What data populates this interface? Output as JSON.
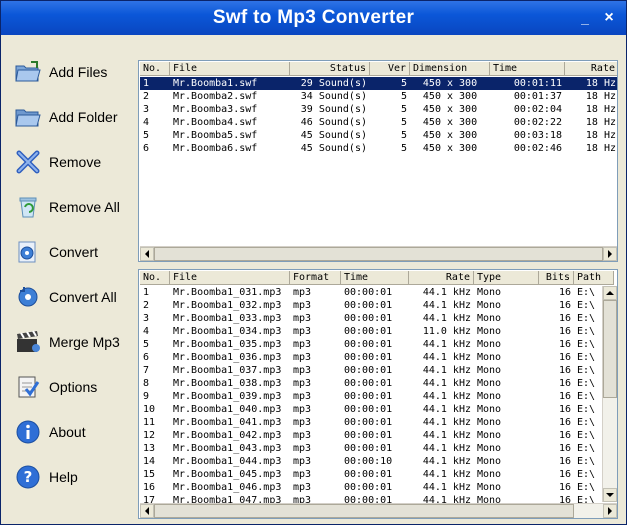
{
  "window": {
    "title": "Swf to Mp3 Converter",
    "minimize": "_",
    "close": "×"
  },
  "colors": {
    "titlebar": "#0b57d8",
    "selection": "#0a246a",
    "face": "#ece9d8"
  },
  "sidebar": {
    "items": [
      {
        "label": "Add Files",
        "icon": "folder-add-files-icon"
      },
      {
        "label": "Add Folder",
        "icon": "folder-icon"
      },
      {
        "label": "Remove",
        "icon": "x-remove-icon"
      },
      {
        "label": "Remove All",
        "icon": "recycle-bin-icon"
      },
      {
        "label": "Convert",
        "icon": "disc-convert-icon"
      },
      {
        "label": "Convert All",
        "icon": "disc-convert-all-icon"
      },
      {
        "label": "Merge Mp3",
        "icon": "clapper-icon"
      },
      {
        "label": "Options",
        "icon": "checklist-icon"
      },
      {
        "label": "About",
        "icon": "info-icon"
      },
      {
        "label": "Help",
        "icon": "help-icon"
      }
    ]
  },
  "source_table": {
    "headers": {
      "no": "No.",
      "file": "File",
      "status": "Status",
      "ver": "Ver",
      "dimension": "Dimension",
      "time": "Time",
      "rate": "Rate"
    },
    "rows": [
      {
        "no": "1",
        "file": "Mr.Boomba1.swf",
        "status": "29 Sound(s)",
        "ver": "5",
        "dimension": "450 x 300",
        "time": "00:01:11",
        "rate": "18 Hz"
      },
      {
        "no": "2",
        "file": "Mr.Boomba2.swf",
        "status": "34 Sound(s)",
        "ver": "5",
        "dimension": "450 x 300",
        "time": "00:01:37",
        "rate": "18 Hz"
      },
      {
        "no": "3",
        "file": "Mr.Boomba3.swf",
        "status": "39 Sound(s)",
        "ver": "5",
        "dimension": "450 x 300",
        "time": "00:02:04",
        "rate": "18 Hz"
      },
      {
        "no": "4",
        "file": "Mr.Boomba4.swf",
        "status": "46 Sound(s)",
        "ver": "5",
        "dimension": "450 x 300",
        "time": "00:02:22",
        "rate": "18 Hz"
      },
      {
        "no": "5",
        "file": "Mr.Boomba5.swf",
        "status": "45 Sound(s)",
        "ver": "5",
        "dimension": "450 x 300",
        "time": "00:03:18",
        "rate": "18 Hz"
      },
      {
        "no": "6",
        "file": "Mr.Boomba6.swf",
        "status": "45 Sound(s)",
        "ver": "5",
        "dimension": "450 x 300",
        "time": "00:02:46",
        "rate": "18 Hz"
      }
    ]
  },
  "sound_table": {
    "headers": {
      "no": "No.",
      "file": "File",
      "format": "Format",
      "time": "Time",
      "rate": "Rate",
      "type": "Type",
      "bits": "Bits",
      "path": "Path"
    },
    "rows": [
      {
        "no": "1",
        "file": "Mr.Boomba1_031.mp3",
        "format": "mp3",
        "time": "00:00:01",
        "rate": "44.1 kHz",
        "type": "Mono",
        "bits": "16",
        "path": "E:\\"
      },
      {
        "no": "2",
        "file": "Mr.Boomba1_032.mp3",
        "format": "mp3",
        "time": "00:00:01",
        "rate": "44.1 kHz",
        "type": "Mono",
        "bits": "16",
        "path": "E:\\"
      },
      {
        "no": "3",
        "file": "Mr.Boomba1_033.mp3",
        "format": "mp3",
        "time": "00:00:01",
        "rate": "44.1 kHz",
        "type": "Mono",
        "bits": "16",
        "path": "E:\\"
      },
      {
        "no": "4",
        "file": "Mr.Boomba1_034.mp3",
        "format": "mp3",
        "time": "00:00:01",
        "rate": "11.0 kHz",
        "type": "Mono",
        "bits": "16",
        "path": "E:\\"
      },
      {
        "no": "5",
        "file": "Mr.Boomba1_035.mp3",
        "format": "mp3",
        "time": "00:00:01",
        "rate": "44.1 kHz",
        "type": "Mono",
        "bits": "16",
        "path": "E:\\"
      },
      {
        "no": "6",
        "file": "Mr.Boomba1_036.mp3",
        "format": "mp3",
        "time": "00:00:01",
        "rate": "44.1 kHz",
        "type": "Mono",
        "bits": "16",
        "path": "E:\\"
      },
      {
        "no": "7",
        "file": "Mr.Boomba1_037.mp3",
        "format": "mp3",
        "time": "00:00:01",
        "rate": "44.1 kHz",
        "type": "Mono",
        "bits": "16",
        "path": "E:\\"
      },
      {
        "no": "8",
        "file": "Mr.Boomba1_038.mp3",
        "format": "mp3",
        "time": "00:00:01",
        "rate": "44.1 kHz",
        "type": "Mono",
        "bits": "16",
        "path": "E:\\"
      },
      {
        "no": "9",
        "file": "Mr.Boomba1_039.mp3",
        "format": "mp3",
        "time": "00:00:01",
        "rate": "44.1 kHz",
        "type": "Mono",
        "bits": "16",
        "path": "E:\\"
      },
      {
        "no": "10",
        "file": "Mr.Boomba1_040.mp3",
        "format": "mp3",
        "time": "00:00:01",
        "rate": "44.1 kHz",
        "type": "Mono",
        "bits": "16",
        "path": "E:\\"
      },
      {
        "no": "11",
        "file": "Mr.Boomba1_041.mp3",
        "format": "mp3",
        "time": "00:00:01",
        "rate": "44.1 kHz",
        "type": "Mono",
        "bits": "16",
        "path": "E:\\"
      },
      {
        "no": "12",
        "file": "Mr.Boomba1_042.mp3",
        "format": "mp3",
        "time": "00:00:01",
        "rate": "44.1 kHz",
        "type": "Mono",
        "bits": "16",
        "path": "E:\\"
      },
      {
        "no": "13",
        "file": "Mr.Boomba1_043.mp3",
        "format": "mp3",
        "time": "00:00:01",
        "rate": "44.1 kHz",
        "type": "Mono",
        "bits": "16",
        "path": "E:\\"
      },
      {
        "no": "14",
        "file": "Mr.Boomba1_044.mp3",
        "format": "mp3",
        "time": "00:00:10",
        "rate": "44.1 kHz",
        "type": "Mono",
        "bits": "16",
        "path": "E:\\"
      },
      {
        "no": "15",
        "file": "Mr.Boomba1_045.mp3",
        "format": "mp3",
        "time": "00:00:01",
        "rate": "44.1 kHz",
        "type": "Mono",
        "bits": "16",
        "path": "E:\\"
      },
      {
        "no": "16",
        "file": "Mr.Boomba1_046.mp3",
        "format": "mp3",
        "time": "00:00:01",
        "rate": "44.1 kHz",
        "type": "Mono",
        "bits": "16",
        "path": "E:\\"
      },
      {
        "no": "17",
        "file": "Mr.Boomba1_047.mp3",
        "format": "mp3",
        "time": "00:00:01",
        "rate": "44.1 kHz",
        "type": "Mono",
        "bits": "16",
        "path": "E:\\"
      }
    ]
  }
}
